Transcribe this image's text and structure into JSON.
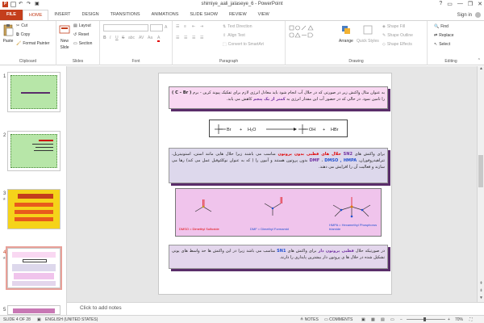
{
  "window": {
    "title": "shimiye_aali_jalaseye_6 - PowerPoint",
    "controls": [
      "?",
      "▭",
      "—",
      "❐",
      "✕"
    ]
  },
  "tabs": [
    "FILE",
    "HOME",
    "INSERT",
    "DESIGN",
    "TRANSITIONS",
    "ANIMATIONS",
    "SLIDE SHOW",
    "REVIEW",
    "VIEW"
  ],
  "account": {
    "label": "Sign in"
  },
  "ribbon": {
    "clipboard": {
      "paste": "Paste",
      "cut": "Cut",
      "copy": "Copy",
      "format_painter": "Format Painter",
      "label": "Clipboard"
    },
    "slides": {
      "new_slide": "New",
      "new_slide2": "Slide",
      "layout": "Layout",
      "reset": "Reset",
      "section": "Section",
      "label": "Slides"
    },
    "font": {
      "label": "Font",
      "bold": "B",
      "italic": "I",
      "underline": "U",
      "strike": "S",
      "shadow": "abc",
      "spacing": "AV",
      "case": "Aa",
      "color": "A"
    },
    "paragraph": {
      "text_direction": "Text Direction",
      "align_text": "Align Text",
      "smartart": "Convert to SmartArt",
      "label": "Paragraph"
    },
    "drawing": {
      "arrange": "Arrange",
      "quick_styles": "Quick Styles",
      "shape_fill": "Shape Fill",
      "shape_outline": "Shape Outline",
      "shape_effects": "Shape Effects",
      "label": "Drawing"
    },
    "editing": {
      "find": "Find",
      "replace": "Replace",
      "select": "Select",
      "label": "Editing"
    }
  },
  "thumbnails": [
    {
      "num": "1",
      "bg": "#b7e6a8"
    },
    {
      "num": "2",
      "bg": "#b7e6a8"
    },
    {
      "num": "3",
      "bg": "#f5d31a"
    },
    {
      "num": "4",
      "bg": "#ffffff"
    },
    {
      "num": "5",
      "bg": "#c878b4"
    }
  ],
  "slide": {
    "para1": {
      "a": "به عنوان مثال واکنش زیر در صورتی که در حلال آب انجام شود باید معادل انرژی لازم برای تفکیک پیوند کربن - برم ",
      "b": "( C – Br )",
      "c": " را تامین نمود. در حالی که در حضور آب این مقدار انرژی به ",
      "d": "کمتر از یک پنجم",
      "e": " کاهش می یابد."
    },
    "reaction": {
      "r1": "Br",
      "plus1": "+",
      "water": "H₂O",
      "p1": "OH",
      "plus2": "+",
      "p2": "HBr"
    },
    "para2": {
      "a": "برای واکنش های ",
      "b": "2",
      "c": "SN",
      "d": " ",
      "e": "حلال های قطبی بدون پروتون",
      "f": " مناسب می باشند زیرا حلال هایی مانند استن، استونیتریل، تترا‌هیدروفوران، ",
      "g": "DMSO , HMPA",
      "h": " ، ",
      "i": "DMF",
      "j": " بدون پروتون هستند و آنیون را ( که به عنوان نوکلئوفیل عمل می کند) رها می سازند و فعالیت آن را افزایش می دهند."
    },
    "solvents": [
      {
        "label": "DMSO = Dimethyl Sulfoxide",
        "color": "#e00000"
      },
      {
        "label": "DMF = Dimethyl Formamid",
        "color": "#1f4fd1"
      },
      {
        "label": "HMPA = Hexamethyl Phosphorus triamide",
        "color": "#1f4fd1"
      }
    ],
    "para3": {
      "a": "در صورتیکه حلال ",
      "b": "قطبی پروتون دار",
      "c": " برای واکنش های ",
      "d": "SN1",
      "e": " مناسب می باشد زیرا در این واکنش ها حد واسط های یونی تشکیل شده در حلال ها ی پروتون دار بیشترین پایداری را دارند."
    }
  },
  "notes": {
    "placeholder": "Click to add notes"
  },
  "status": {
    "slide_of": "SLIDE 4 OF 28",
    "language": "ENGLISH (UNITED STATES)",
    "notes": "NOTES",
    "comments": "COMMENTS",
    "zoom": "70%"
  },
  "colors": {
    "accent": "#c43e1c",
    "emphasis_purple": "#7030a0",
    "emphasis_red": "#e00000",
    "emphasis_blue": "#1f4fd1"
  }
}
